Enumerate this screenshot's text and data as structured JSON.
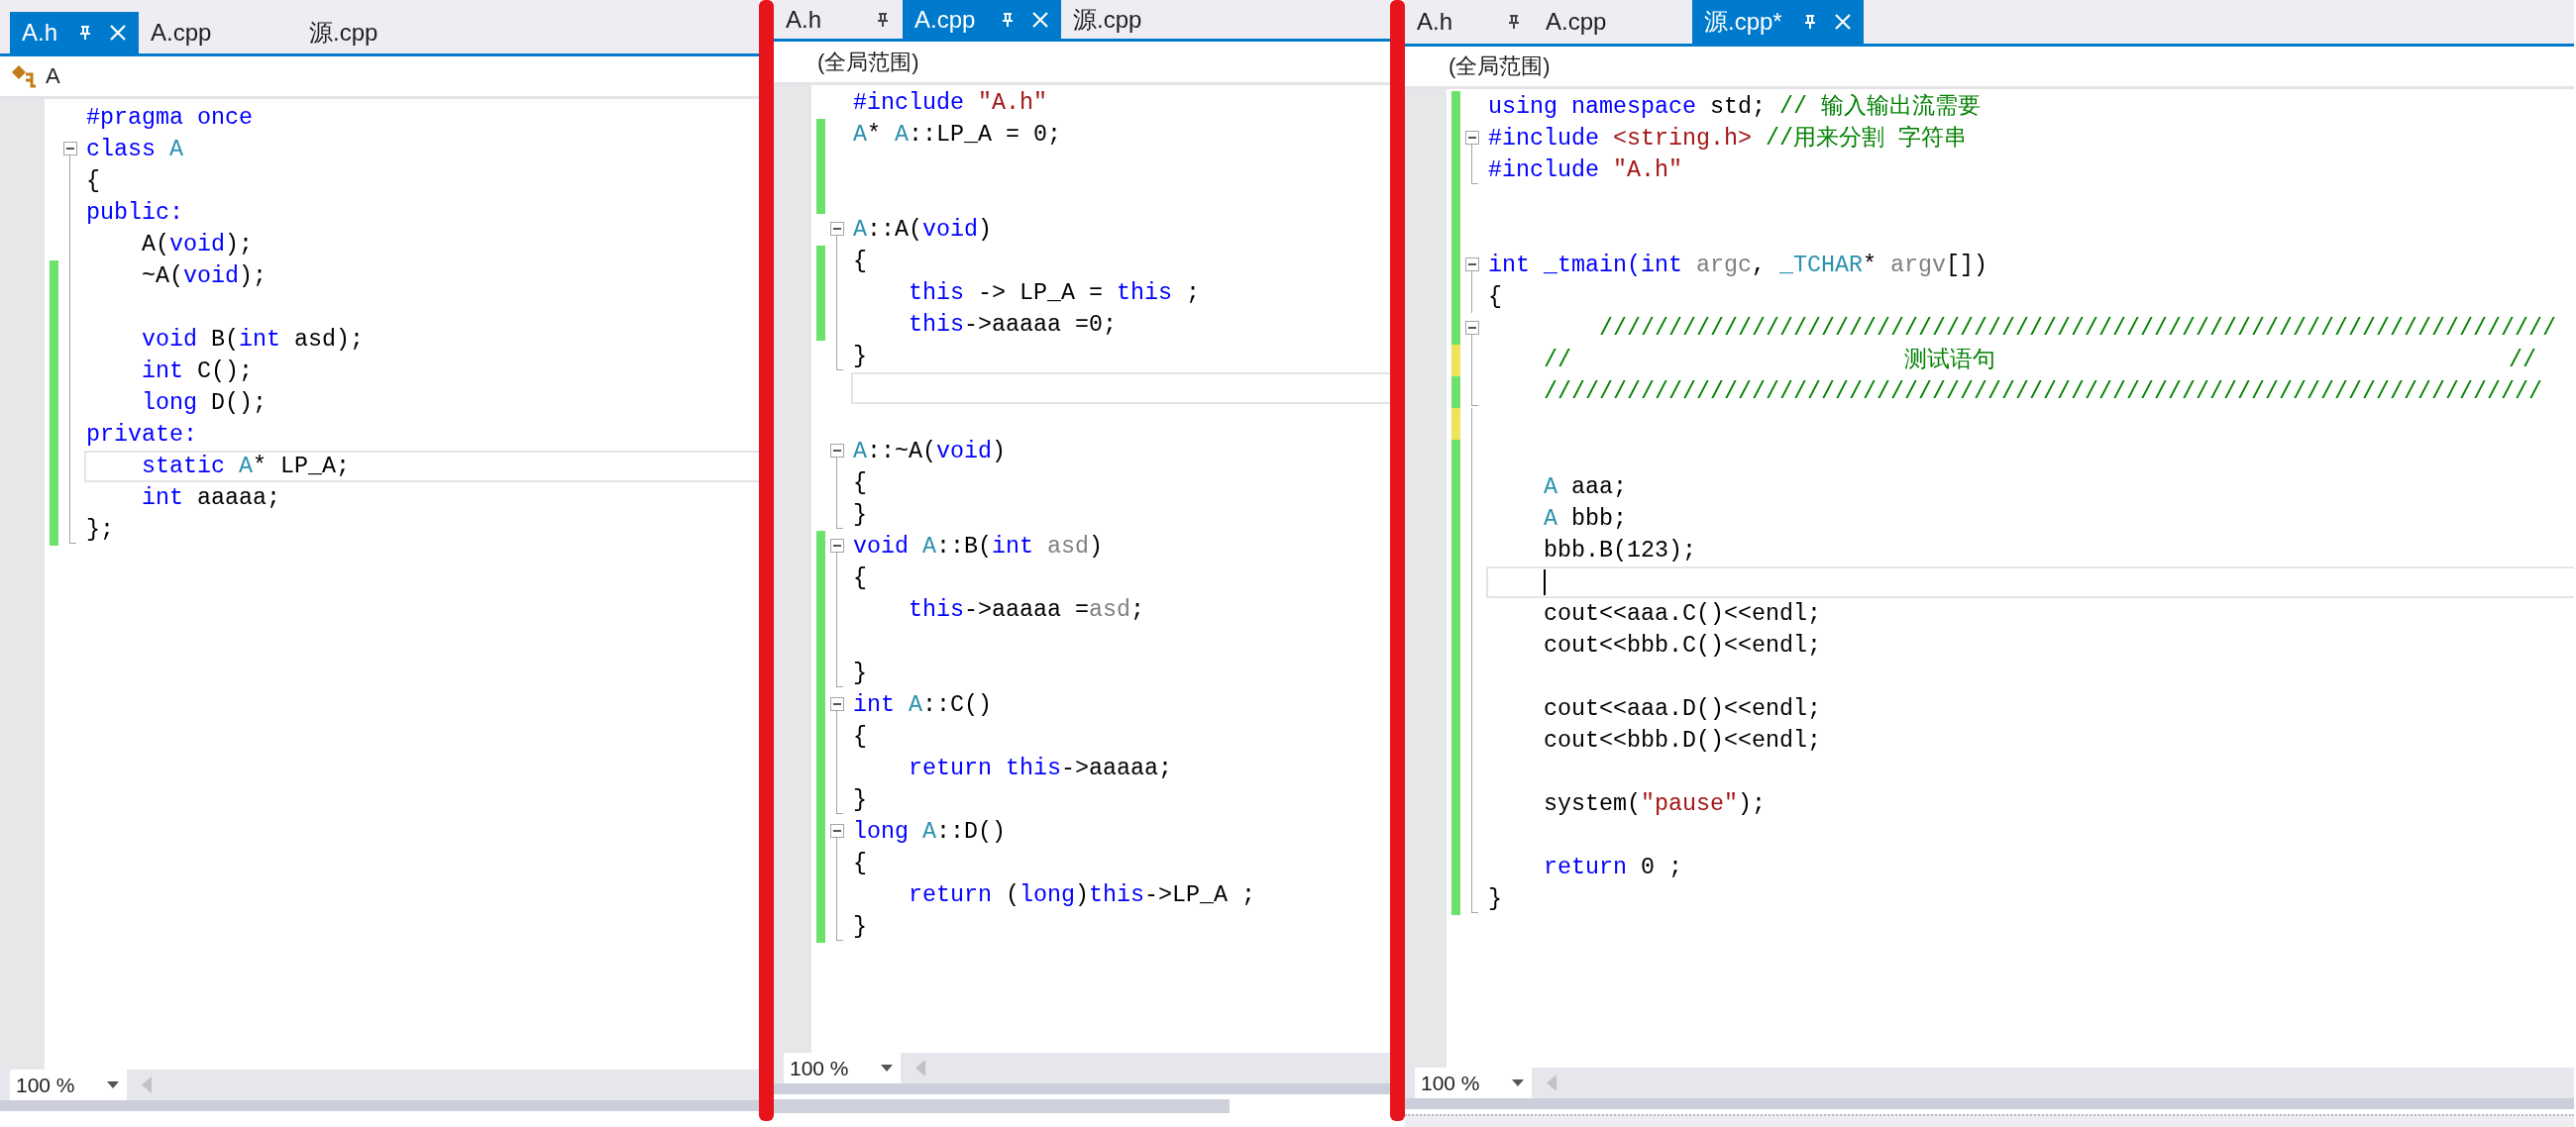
{
  "panes": [
    {
      "tabs": [
        {
          "label": "A.h",
          "selected": true,
          "pinned": true
        },
        {
          "label": "A.cpp",
          "selected": false,
          "pinned": false
        },
        {
          "label": "源.cpp",
          "selected": false,
          "pinned": false
        }
      ],
      "nav": {
        "kind": "class",
        "text": "A"
      },
      "caret_on_current_line": false,
      "zoom": "100 %",
      "lines": [
        {
          "kind": "plain",
          "current": false,
          "tokens": [
            {
              "kind": "kw",
              "s": "#pragma once"
            }
          ]
        },
        {
          "kind": "fold-open",
          "current": false,
          "tokens": [
            {
              "kind": "kw",
              "s": "class "
            },
            {
              "kind": "ty",
              "s": "A"
            }
          ]
        },
        {
          "kind": "fold-body",
          "current": false,
          "tokens": [
            {
              "kind": "pl",
              "s": "{"
            }
          ]
        },
        {
          "kind": "fold-body",
          "current": false,
          "tokens": [
            {
              "kind": "kw",
              "s": "public:"
            }
          ]
        },
        {
          "kind": "fold-body",
          "current": false,
          "tokens": [
            {
              "kind": "pl",
              "s": "    A("
            },
            {
              "kind": "kw",
              "s": "void"
            },
            {
              "kind": "pl",
              "s": ");"
            }
          ]
        },
        {
          "kind": "fold-body",
          "current": false,
          "color": "#6ce26c",
          "tokens": [
            {
              "kind": "pl",
              "s": "    ~A("
            },
            {
              "kind": "kw",
              "s": "void"
            },
            {
              "kind": "pl",
              "s": ");"
            }
          ]
        },
        {
          "kind": "fold-body",
          "current": false,
          "color": "#6ce26c"
        },
        {
          "kind": "fold-body",
          "current": false,
          "color": "#6ce26c",
          "tokens": [
            {
              "kind": "kw",
              "s": "    void"
            },
            {
              "kind": "pl",
              "s": " B("
            },
            {
              "kind": "kw",
              "s": "int"
            },
            {
              "kind": "pl",
              "s": " asd);"
            }
          ]
        },
        {
          "kind": "fold-body",
          "current": false,
          "color": "#6ce26c",
          "tokens": [
            {
              "kind": "kw",
              "s": "    int"
            },
            {
              "kind": "pl",
              "s": " C();"
            }
          ]
        },
        {
          "kind": "fold-body",
          "current": false,
          "color": "#6ce26c",
          "tokens": [
            {
              "kind": "kw",
              "s": "    long"
            },
            {
              "kind": "pl",
              "s": " D();"
            }
          ]
        },
        {
          "kind": "fold-body",
          "current": false,
          "color": "#6ce26c",
          "tokens": [
            {
              "kind": "kw",
              "s": "private:"
            }
          ]
        },
        {
          "kind": "fold-body",
          "current": true,
          "color": "#6ce26c",
          "tokens": [
            {
              "kind": "kw",
              "s": "    static "
            },
            {
              "kind": "ty",
              "s": "A"
            },
            {
              "kind": "pl",
              "s": "* LP_A;"
            }
          ]
        },
        {
          "kind": "fold-body",
          "current": false,
          "color": "#6ce26c",
          "tokens": [
            {
              "kind": "kw",
              "s": "    int"
            },
            {
              "kind": "pl",
              "s": " aaaaa;"
            }
          ]
        },
        {
          "kind": "fold-end",
          "current": false,
          "color": "#6ce26c",
          "tokens": [
            {
              "kind": "pl",
              "s": "};"
            }
          ]
        }
      ]
    },
    {
      "tabs": [
        {
          "label": "A.h",
          "selected": false,
          "pinned": true
        },
        {
          "label": "A.cpp",
          "selected": true,
          "pinned": true
        },
        {
          "label": "源.cpp",
          "selected": false,
          "pinned": false
        }
      ],
      "nav": {
        "kind": "scope",
        "text": "(全局范围)"
      },
      "caret_on_current_line": false,
      "zoom": "100 %",
      "lines": [
        {
          "kind": "plain",
          "current": false,
          "tokens": [
            {
              "kind": "kw",
              "s": "#include "
            },
            {
              "kind": "st",
              "s": "\"A.h\""
            }
          ]
        },
        {
          "kind": "plain",
          "current": false,
          "color": "#6ce26c",
          "tokens": [
            {
              "kind": "ty",
              "s": "A"
            },
            {
              "kind": "pl",
              "s": "* "
            },
            {
              "kind": "ty",
              "s": "A"
            },
            {
              "kind": "pl",
              "s": "::LP_A = 0;"
            }
          ]
        },
        {
          "kind": "plain",
          "current": false,
          "color": "#6ce26c"
        },
        {
          "kind": "plain",
          "current": false,
          "color": "#6ce26c"
        },
        {
          "kind": "fold-open",
          "current": false,
          "tokens": [
            {
              "kind": "ty",
              "s": "A"
            },
            {
              "kind": "pl",
              "s": "::A("
            },
            {
              "kind": "kw",
              "s": "void"
            },
            {
              "kind": "pl",
              "s": ")"
            }
          ]
        },
        {
          "kind": "fold-body",
          "current": false,
          "color": "#6ce26c",
          "tokens": [
            {
              "kind": "pl",
              "s": "{"
            }
          ]
        },
        {
          "kind": "fold-body",
          "current": false,
          "color": "#6ce26c",
          "tokens": [
            {
              "kind": "kw",
              "s": "    this"
            },
            {
              "kind": "pl",
              "s": " -> LP_A = "
            },
            {
              "kind": "kw",
              "s": "this"
            },
            {
              "kind": "pl",
              "s": " ;"
            }
          ]
        },
        {
          "kind": "fold-body",
          "current": false,
          "color": "#6ce26c",
          "tokens": [
            {
              "kind": "kw",
              "s": "    this"
            },
            {
              "kind": "pl",
              "s": "->aaaaa =0;"
            }
          ]
        },
        {
          "kind": "fold-end",
          "current": false,
          "tokens": [
            {
              "kind": "pl",
              "s": "}"
            }
          ]
        },
        {
          "kind": "plain",
          "current": true
        },
        {
          "kind": "plain",
          "current": false
        },
        {
          "kind": "fold-open",
          "current": false,
          "tokens": [
            {
              "kind": "ty",
              "s": "A"
            },
            {
              "kind": "pl",
              "s": "::~A("
            },
            {
              "kind": "kw",
              "s": "void"
            },
            {
              "kind": "pl",
              "s": ")"
            }
          ]
        },
        {
          "kind": "fold-body",
          "current": false,
          "tokens": [
            {
              "kind": "pl",
              "s": "{"
            }
          ]
        },
        {
          "kind": "fold-end",
          "current": false,
          "tokens": [
            {
              "kind": "pl",
              "s": "}"
            }
          ]
        },
        {
          "kind": "fold-open",
          "current": false,
          "color": "#6ce26c",
          "tokens": [
            {
              "kind": "kw",
              "s": "void "
            },
            {
              "kind": "ty",
              "s": "A"
            },
            {
              "kind": "pl",
              "s": "::B("
            },
            {
              "kind": "kw",
              "s": "int"
            },
            {
              "kind": "pa",
              "s": " asd"
            },
            {
              "kind": "pl",
              "s": ")"
            }
          ]
        },
        {
          "kind": "fold-body",
          "current": false,
          "color": "#6ce26c",
          "tokens": [
            {
              "kind": "pl",
              "s": "{"
            }
          ]
        },
        {
          "kind": "fold-body",
          "current": false,
          "color": "#6ce26c",
          "tokens": [
            {
              "kind": "kw",
              "s": "    this"
            },
            {
              "kind": "pl",
              "s": "->aaaaa ="
            },
            {
              "kind": "pa",
              "s": "asd"
            },
            {
              "kind": "pl",
              "s": ";"
            }
          ]
        },
        {
          "kind": "fold-body",
          "current": false,
          "color": "#6ce26c"
        },
        {
          "kind": "fold-end",
          "current": false,
          "color": "#6ce26c",
          "tokens": [
            {
              "kind": "pl",
              "s": "}"
            }
          ]
        },
        {
          "kind": "fold-open",
          "current": false,
          "color": "#6ce26c",
          "tokens": [
            {
              "kind": "kw",
              "s": "int "
            },
            {
              "kind": "ty",
              "s": "A"
            },
            {
              "kind": "pl",
              "s": "::C()"
            }
          ]
        },
        {
          "kind": "fold-body",
          "current": false,
          "color": "#6ce26c",
          "tokens": [
            {
              "kind": "pl",
              "s": "{"
            }
          ]
        },
        {
          "kind": "fold-body",
          "current": false,
          "color": "#6ce26c",
          "tokens": [
            {
              "kind": "kw",
              "s": "    return this"
            },
            {
              "kind": "pl",
              "s": "->aaaaa;"
            }
          ]
        },
        {
          "kind": "fold-end",
          "current": false,
          "color": "#6ce26c",
          "tokens": [
            {
              "kind": "pl",
              "s": "}"
            }
          ]
        },
        {
          "kind": "fold-open",
          "current": false,
          "color": "#6ce26c",
          "tokens": [
            {
              "kind": "kw",
              "s": "long "
            },
            {
              "kind": "ty",
              "s": "A"
            },
            {
              "kind": "pl",
              "s": "::D()"
            }
          ]
        },
        {
          "kind": "fold-body",
          "current": false,
          "color": "#6ce26c",
          "tokens": [
            {
              "kind": "pl",
              "s": "{"
            }
          ]
        },
        {
          "kind": "fold-body",
          "current": false,
          "color": "#6ce26c",
          "tokens": [
            {
              "kind": "kw",
              "s": "    return "
            },
            {
              "kind": "pl",
              "s": "("
            },
            {
              "kind": "kw",
              "s": "long"
            },
            {
              "kind": "pl",
              "s": ")"
            },
            {
              "kind": "kw",
              "s": "this"
            },
            {
              "kind": "pl",
              "s": "->LP_A ;"
            }
          ]
        },
        {
          "kind": "fold-end",
          "current": false,
          "color": "#6ce26c",
          "tokens": [
            {
              "kind": "pl",
              "s": "}"
            }
          ]
        }
      ]
    },
    {
      "tabs": [
        {
          "label": "A.h",
          "selected": false,
          "pinned": true
        },
        {
          "label": "A.cpp",
          "selected": false,
          "pinned": false
        },
        {
          "label": "源.cpp*",
          "selected": true,
          "pinned": true
        }
      ],
      "nav": {
        "kind": "scope",
        "text": "(全局范围)"
      },
      "caret_on_current_line": true,
      "zoom": "100 %",
      "lines": [
        {
          "kind": "plain",
          "current": false,
          "color": "#6ce26c",
          "tokens": [
            {
              "kind": "kw",
              "s": "using namespace "
            },
            {
              "kind": "pl",
              "s": "std; "
            },
            {
              "kind": "cm",
              "s": "// 输入输出流需要"
            }
          ]
        },
        {
          "kind": "fold-open",
          "current": false,
          "color": "#6ce26c",
          "tokens": [
            {
              "kind": "kw",
              "s": "#include "
            },
            {
              "kind": "st",
              "s": "<string.h>"
            },
            {
              "kind": "cm",
              "s": " //用来分割 字符串"
            }
          ]
        },
        {
          "kind": "fold-end",
          "current": false,
          "color": "#6ce26c",
          "tokens": [
            {
              "kind": "kw",
              "s": "#include "
            },
            {
              "kind": "st",
              "s": "\"A.h\""
            }
          ]
        },
        {
          "kind": "plain",
          "current": false,
          "color": "#6ce26c"
        },
        {
          "kind": "plain",
          "current": false,
          "color": "#6ce26c"
        },
        {
          "kind": "fold-open",
          "current": false,
          "color": "#6ce26c",
          "tokens": [
            {
              "kind": "kw",
              "s": "int _tmain(int "
            },
            {
              "kind": "pa",
              "s": "argc"
            },
            {
              "kind": "pl",
              "s": ", "
            },
            {
              "kind": "ty",
              "s": "_TCHAR"
            },
            {
              "kind": "pl",
              "s": "* "
            },
            {
              "kind": "pa",
              "s": "argv"
            },
            {
              "kind": "pl",
              "s": "[])"
            }
          ]
        },
        {
          "kind": "fold-body",
          "current": false,
          "color": "#6ce26c",
          "tokens": [
            {
              "kind": "pl",
              "s": "{"
            }
          ]
        },
        {
          "kind": "fold-open",
          "current": false,
          "color": "#6ce26c",
          "tokens": [
            {
              "kind": "cm",
              "s": "        /////////////////////////////////////////////////////////////////////"
            }
          ]
        },
        {
          "kind": "fold-body",
          "current": false,
          "color": "#eee35a",
          "tokens": [
            {
              "kind": "cm",
              "s": "    //                        测试语句                                     //"
            }
          ]
        },
        {
          "kind": "fold-end",
          "current": false,
          "color": "#6ce26c",
          "tokens": [
            {
              "kind": "cm",
              "s": "    ////////////////////////////////////////////////////////////////////////"
            }
          ]
        },
        {
          "kind": "fold-body",
          "current": false,
          "color": "#eee35a"
        },
        {
          "kind": "fold-body",
          "current": false,
          "color": "#6ce26c"
        },
        {
          "kind": "fold-body",
          "current": false,
          "color": "#6ce26c",
          "tokens": [
            {
              "kind": "ty",
              "s": "    A"
            },
            {
              "kind": "pl",
              "s": " aaa;"
            }
          ]
        },
        {
          "kind": "fold-body",
          "current": false,
          "color": "#6ce26c",
          "tokens": [
            {
              "kind": "ty",
              "s": "    A"
            },
            {
              "kind": "pl",
              "s": " bbb;"
            }
          ]
        },
        {
          "kind": "fold-body",
          "current": false,
          "color": "#6ce26c",
          "tokens": [
            {
              "kind": "pl",
              "s": "    bbb.B(123);"
            }
          ]
        },
        {
          "kind": "fold-body",
          "current": true,
          "color": "#6ce26c"
        },
        {
          "kind": "fold-body",
          "current": false,
          "color": "#6ce26c",
          "tokens": [
            {
              "kind": "pl",
              "s": "    cout<<aaa.C()<<endl;"
            }
          ]
        },
        {
          "kind": "fold-body",
          "current": false,
          "color": "#6ce26c",
          "tokens": [
            {
              "kind": "pl",
              "s": "    cout<<bbb.C()<<endl;"
            }
          ]
        },
        {
          "kind": "fold-body",
          "current": false,
          "color": "#6ce26c"
        },
        {
          "kind": "fold-body",
          "current": false,
          "color": "#6ce26c",
          "tokens": [
            {
              "kind": "pl",
              "s": "    cout<<aaa.D()<<endl;"
            }
          ]
        },
        {
          "kind": "fold-body",
          "current": false,
          "color": "#6ce26c",
          "tokens": [
            {
              "kind": "pl",
              "s": "    cout<<bbb.D()<<endl;"
            }
          ]
        },
        {
          "kind": "fold-body",
          "current": false,
          "color": "#6ce26c"
        },
        {
          "kind": "fold-body",
          "current": false,
          "color": "#6ce26c",
          "tokens": [
            {
              "kind": "pl",
              "s": "    system("
            },
            {
              "kind": "st",
              "s": "\"pause\""
            },
            {
              "kind": "pl",
              "s": ");"
            }
          ]
        },
        {
          "kind": "fold-body",
          "current": false,
          "color": "#6ce26c"
        },
        {
          "kind": "fold-body",
          "current": false,
          "color": "#6ce26c",
          "tokens": [
            {
              "kind": "kw",
              "s": "    return"
            },
            {
              "kind": "pl",
              "s": " 0 ;"
            }
          ]
        },
        {
          "kind": "fold-end",
          "current": false,
          "color": "#6ce26c",
          "tokens": [
            {
              "kind": "pl",
              "s": "}"
            }
          ]
        }
      ]
    }
  ]
}
